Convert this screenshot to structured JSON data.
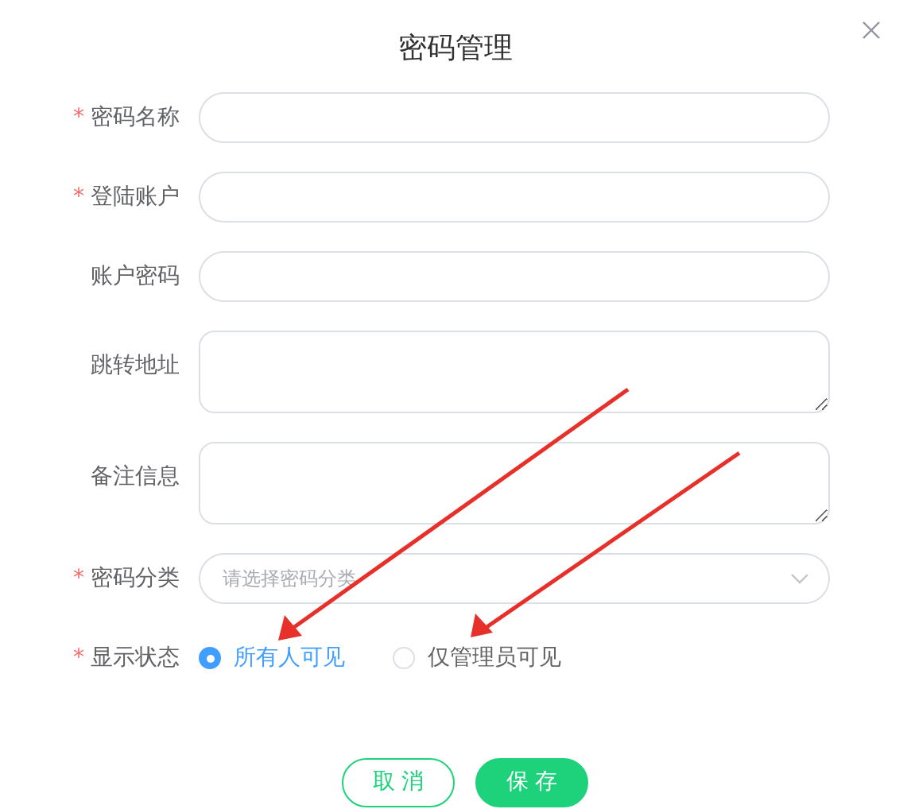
{
  "dialog": {
    "title": "密码管理"
  },
  "fields": [
    {
      "kind": "input",
      "label": "密码名称",
      "required_mark": "*"
    },
    {
      "kind": "input",
      "label": "登陆账户",
      "required_mark": "*"
    },
    {
      "kind": "input",
      "label": "账户密码"
    },
    {
      "kind": "textarea",
      "label": "跳转地址"
    },
    {
      "kind": "textarea",
      "label": "备注信息"
    },
    {
      "kind": "select",
      "label": "密码分类",
      "required_mark": "*",
      "placeholder": "请选择密码分类"
    }
  ],
  "status": {
    "label": "显示状态",
    "required_mark": "*",
    "options": [
      {
        "label": "所有人可见",
        "selected": true
      },
      {
        "label": "仅管理员可见",
        "selected": false
      }
    ]
  },
  "buttons": [
    {
      "kind": "secondary",
      "label": "取 消"
    },
    {
      "kind": "primary",
      "label": "保 存"
    }
  ]
}
